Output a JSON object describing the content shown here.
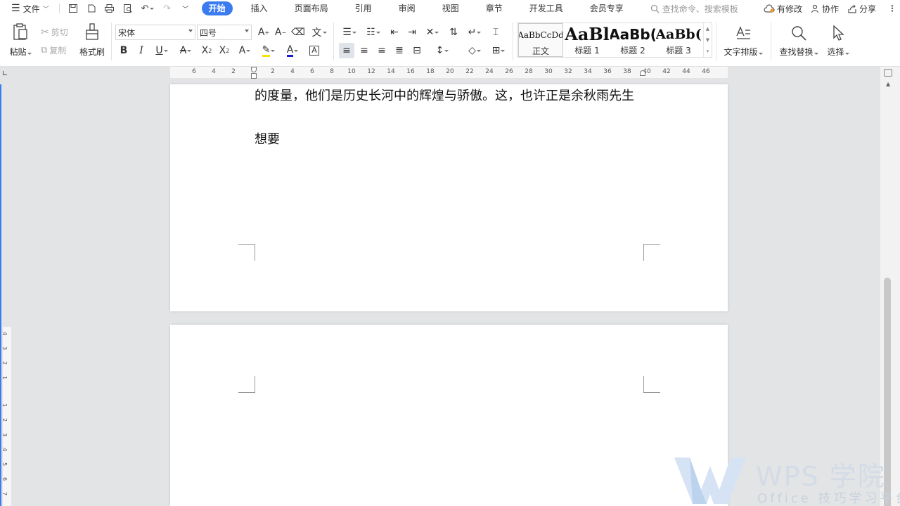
{
  "menubar": {
    "file_label": "文件",
    "tabs": [
      {
        "label": "开始",
        "active": true
      },
      {
        "label": "插入"
      },
      {
        "label": "页面布局"
      },
      {
        "label": "引用"
      },
      {
        "label": "审阅"
      },
      {
        "label": "视图"
      },
      {
        "label": "章节"
      },
      {
        "label": "开发工具"
      },
      {
        "label": "会员专享"
      }
    ],
    "search_placeholder": "查找命令、搜索模板",
    "right": {
      "modify": "有修改",
      "collab": "协作",
      "share": "分享"
    }
  },
  "ribbon": {
    "paste": "粘贴",
    "cut": "剪切",
    "copy": "复制",
    "format_painter": "格式刷",
    "font_name": "宋体",
    "font_size": "四号",
    "styles": [
      {
        "sample": "AaBbCcDd",
        "name": "正文"
      },
      {
        "sample": "AaBl",
        "name": "标题 1"
      },
      {
        "sample": "AaBb(",
        "name": "标题 2"
      },
      {
        "sample": "AaBb(",
        "name": "标题 3"
      }
    ],
    "text_layout": "文字排版",
    "find_replace": "查找替换",
    "select": "选择"
  },
  "ruler": {
    "ticks": [
      "6",
      "4",
      "2",
      "2",
      "4",
      "6",
      "8",
      "10",
      "12",
      "14",
      "16",
      "18",
      "20",
      "22",
      "24",
      "26",
      "28",
      "30",
      "32",
      "34",
      "36",
      "38",
      "40",
      "42",
      "44",
      "46"
    ]
  },
  "vruler": {
    "top_ticks": [
      "4",
      "3",
      "2",
      "1"
    ],
    "bottom_ticks": [
      "1",
      "2",
      "3",
      "4",
      "5",
      "6",
      "7"
    ]
  },
  "document": {
    "line1": "的度量，他们是历史长河中的辉煌与骄傲。这，也许正是余秋雨先生",
    "line2": "想要"
  },
  "watermark": {
    "title": "WPS 学院",
    "subtitle": "Office 技巧学习平台"
  },
  "colors": {
    "accent": "#3a7cf0",
    "highlight": "#f5e400",
    "font_color": "#1a1acc"
  }
}
